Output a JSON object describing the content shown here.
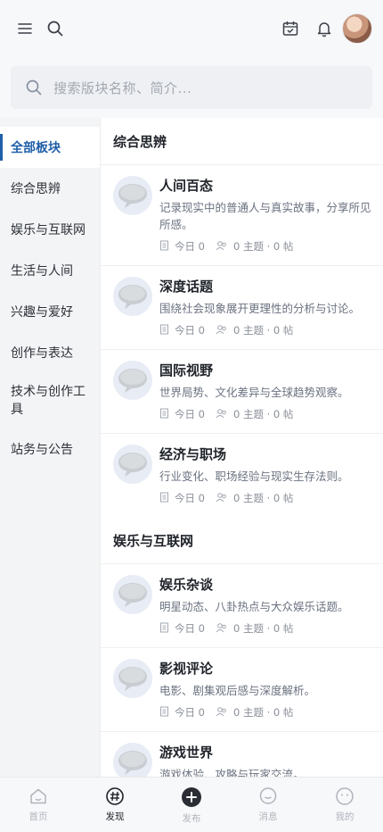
{
  "header": {
    "menu_icon": "menu-icon",
    "search_icon": "search-icon",
    "calendar_icon": "calendar-check-icon",
    "bell_icon": "bell-icon"
  },
  "search": {
    "placeholder": "搜索版块名称、简介..."
  },
  "sidebar": {
    "items": [
      {
        "label": "全部板块",
        "active": true
      },
      {
        "label": "综合思辨"
      },
      {
        "label": "娱乐与互联网"
      },
      {
        "label": "生活与人间"
      },
      {
        "label": "兴趣与爱好"
      },
      {
        "label": "创作与表达"
      },
      {
        "label": "技术与创作工具"
      },
      {
        "label": "站务与公告"
      }
    ]
  },
  "sections": [
    {
      "title": "综合思辨",
      "forums": [
        {
          "name": "人间百态",
          "desc": "记录现实中的普通人与真实故事，分享所见所感。",
          "today": "今日 0",
          "counts": "0 主题 · 0 帖"
        },
        {
          "name": "深度话题",
          "desc": "围绕社会现象展开更理性的分析与讨论。",
          "today": "今日 0",
          "counts": "0 主题 · 0 帖"
        },
        {
          "name": "国际视野",
          "desc": "世界局势、文化差异与全球趋势观察。",
          "today": "今日 0",
          "counts": "0 主题 · 0 帖"
        },
        {
          "name": "经济与职场",
          "desc": "行业变化、职场经验与现实生存法则。",
          "today": "今日 0",
          "counts": "0 主题 · 0 帖"
        }
      ]
    },
    {
      "title": "娱乐与互联网",
      "forums": [
        {
          "name": "娱乐杂谈",
          "desc": "明星动态、八卦热点与大众娱乐话题。",
          "today": "今日 0",
          "counts": "0 主题 · 0 帖"
        },
        {
          "name": "影视评论",
          "desc": "电影、剧集观后感与深度解析。",
          "today": "今日 0",
          "counts": "0 主题 · 0 帖"
        },
        {
          "name": "游戏世界",
          "desc": "游戏体验、攻略与玩家交流。",
          "today": "",
          "counts": ""
        }
      ]
    }
  ],
  "bottom_nav": [
    {
      "label": "首页",
      "icon": "home-icon"
    },
    {
      "label": "发现",
      "icon": "hashtag-icon",
      "active": true
    },
    {
      "label": "发布",
      "icon": "plus-circle-icon"
    },
    {
      "label": "消息",
      "icon": "chat-icon"
    },
    {
      "label": "我的",
      "icon": "user-face-icon"
    }
  ],
  "colors": {
    "accent": "#1f5fa8",
    "sidebar_bg": "#f3f4f6",
    "search_bg": "#eef0f3"
  }
}
